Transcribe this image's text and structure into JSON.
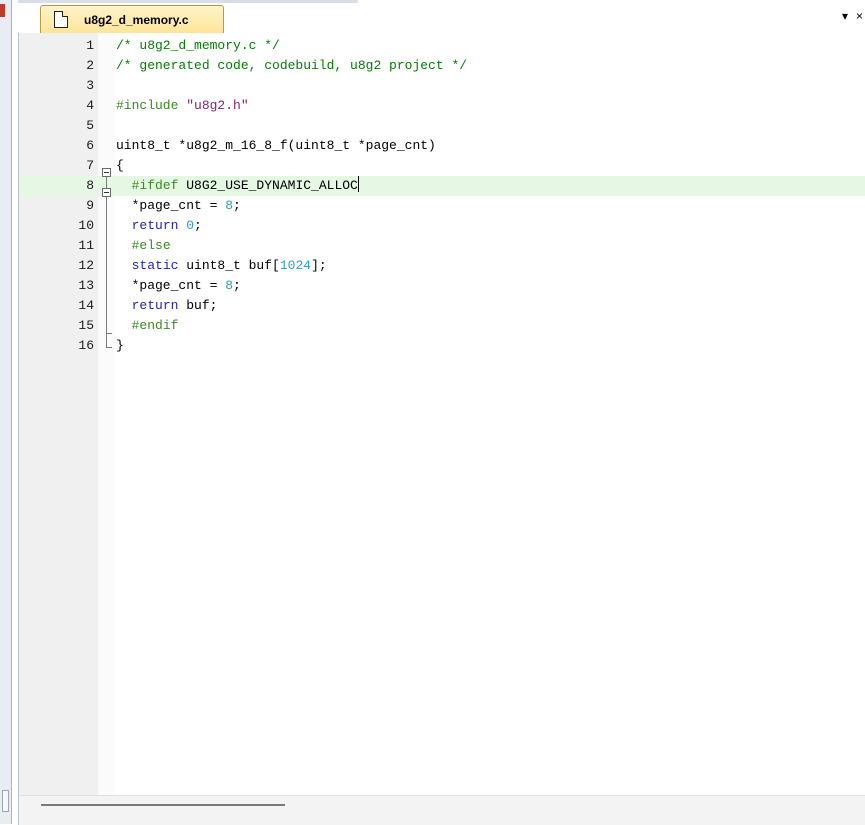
{
  "editor": {
    "tab_label": "u8g2_d_memory.c",
    "tab_menu_icon": "▾",
    "tab_close_icon": "×",
    "active_line": 8,
    "lines": [
      {
        "n": "1",
        "html": "<span class=\"c-comment\">/* u8g2_d_memory.c */</span>"
      },
      {
        "n": "2",
        "html": "<span class=\"c-comment\">/* generated code, codebuild, u8g2 project */</span>"
      },
      {
        "n": "3",
        "html": ""
      },
      {
        "n": "4",
        "html": "<span class=\"c-pre\">#include </span><span class=\"c-string\">\"u8g2.h\"</span>"
      },
      {
        "n": "5",
        "html": ""
      },
      {
        "n": "6",
        "html": "uint8_t *u8g2_m_16_8_f(uint8_t *page_cnt)"
      },
      {
        "n": "7",
        "html": "{"
      },
      {
        "n": "8",
        "html": "  <span class=\"c-pre\">#ifdef</span> U8G2_USE_DYNAMIC_ALLOC<span class=\"caret\"></span>"
      },
      {
        "n": "9",
        "html": "  *page_cnt = <span class=\"c-num\">8</span>;"
      },
      {
        "n": "10",
        "html": "  <span class=\"c-kw\">return</span> <span class=\"c-num\">0</span>;"
      },
      {
        "n": "11",
        "html": "  <span class=\"c-pre\">#else</span>"
      },
      {
        "n": "12",
        "html": "  <span class=\"c-kw\">static</span> uint8_t buf[<span class=\"c-num\">1024</span>];"
      },
      {
        "n": "13",
        "html": "  *page_cnt = <span class=\"c-num\">8</span>;"
      },
      {
        "n": "14",
        "html": "  <span class=\"c-kw\">return</span> buf;"
      },
      {
        "n": "15",
        "html": "  <span class=\"c-pre\">#endif</span>"
      },
      {
        "n": "16",
        "html": "}"
      }
    ]
  }
}
